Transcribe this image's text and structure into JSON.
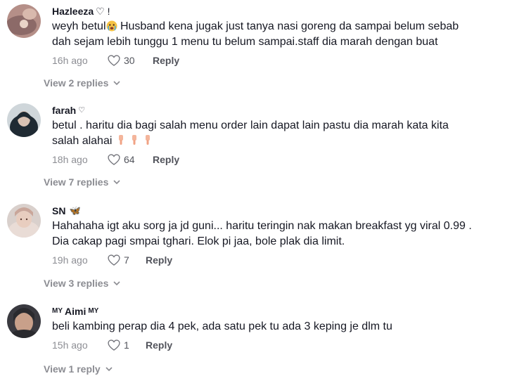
{
  "comments": [
    {
      "username": "Hazleeza",
      "username_suffix": "♡ !",
      "text_before_emoji": "weyh betul",
      "text_after_emoji": " Husband kena jugak just tanya nasi goreng da sampai belum sebab\ndah sejam lebih tunggu 1 menu tu belum sampai.staff dia marah dengan buat",
      "time": "16h ago",
      "likes": "30",
      "reply_label": "Reply",
      "view_replies": "View 2 replies",
      "avatar_colors": [
        "#9b7b7a",
        "#c79b8f"
      ]
    },
    {
      "username": "farah",
      "username_suffix": "♡",
      "text": "betul . haritu dia bagi salah menu order lain dapat lain pastu dia marah kata kita\nsalah alahai ",
      "time": "18h ago",
      "likes": "64",
      "reply_label": "Reply",
      "view_replies": "View 7 replies",
      "avatar_colors": [
        "#1f2a33",
        "#d9c2b4"
      ]
    },
    {
      "username": "SN",
      "username_suffix": "🦋",
      "text": "Hahahaha igt aku sorg ja jd guni... haritu teringin nak makan breakfast yg viral 0.99 .\nDia cakap pagi smpai tghari. Elok pi jaa, bole plak dia limit.",
      "time": "19h ago",
      "likes": "7",
      "reply_label": "Reply",
      "view_replies": "View 3 replies",
      "avatar_colors": [
        "#e9dcd6",
        "#c9a69a"
      ]
    },
    {
      "username_prefix": "MY",
      "username": "Aimi",
      "username_suffix": "MY",
      "text": "beli kambing perap dia 4 pek, ada satu pek tu ada 3 keping je dlm tu",
      "time": "15h ago",
      "likes": "1",
      "reply_label": "Reply",
      "view_replies": "View 1 reply",
      "avatar_colors": [
        "#2a2a2e",
        "#c8a08a"
      ]
    }
  ],
  "icons": {
    "like": "heart-outline-icon",
    "expand": "chevron-down-icon"
  },
  "colors": {
    "text_primary": "#161823",
    "text_secondary": "rgba(22,24,35,0.5)",
    "accent_butterfly": "#e0436b"
  }
}
